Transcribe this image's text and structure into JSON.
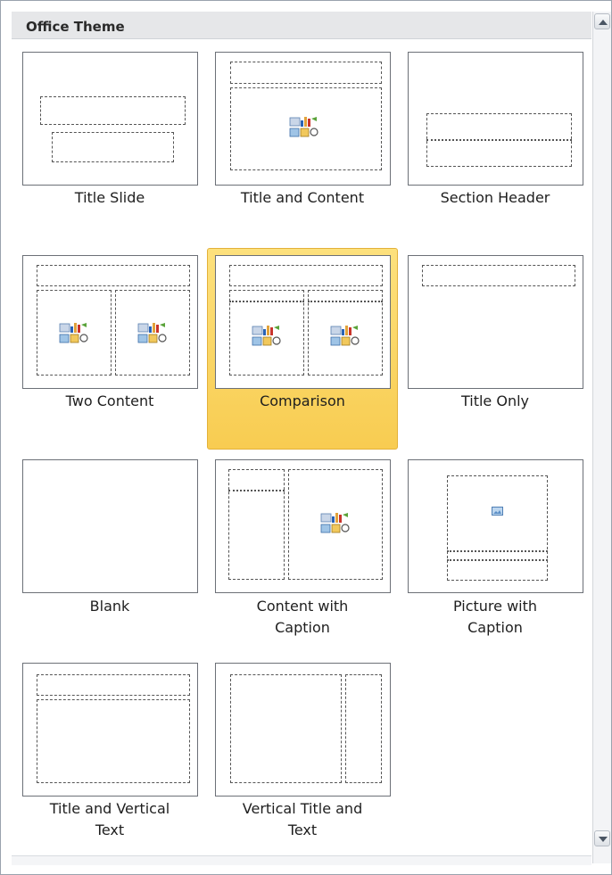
{
  "panel": {
    "title": "Office Theme"
  },
  "layouts": [
    {
      "label": "Title Slide"
    },
    {
      "label": "Title and Content"
    },
    {
      "label": "Section Header"
    },
    {
      "label": "Two Content"
    },
    {
      "label": "Comparison",
      "selected": true
    },
    {
      "label": "Title Only"
    },
    {
      "label": "Blank"
    },
    {
      "label": "Content with\nCaption"
    },
    {
      "label": "Picture with\nCaption"
    },
    {
      "label": "Title and Vertical\nText"
    },
    {
      "label": "Vertical Title and\nText"
    }
  ],
  "colors": {
    "selected_fill": "#f9d565",
    "border": "#6c7077"
  },
  "icons": {
    "content": "content-placeholder-icon",
    "picture": "picture-placeholder-icon"
  }
}
